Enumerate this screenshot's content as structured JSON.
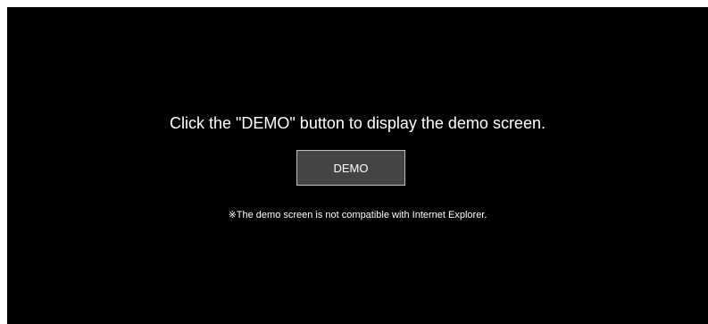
{
  "main": {
    "message": "Click the \"DEMO\" button to display the demo screen.",
    "demo_button_label": "DEMO",
    "note": "※The demo screen is not compatible with Internet Explorer."
  },
  "colors": {
    "background": "#000000",
    "page_margin": "#ffffff",
    "button_background": "#444444",
    "button_border": "#bdbdbd",
    "text": "#ffffff"
  }
}
